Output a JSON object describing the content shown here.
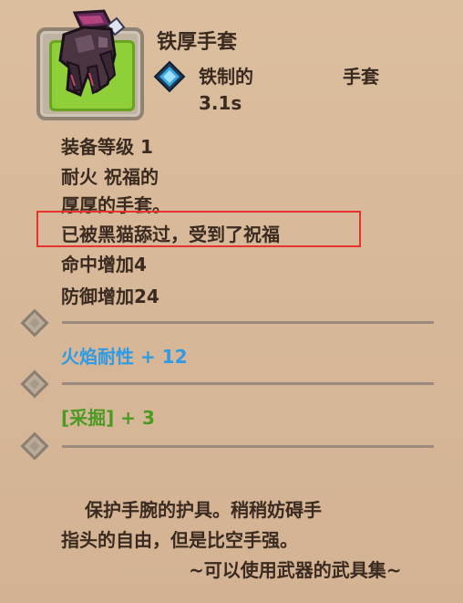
{
  "item": {
    "title": "铁厚手套",
    "material": "铁制的",
    "category": "手套",
    "speed": "3.1s",
    "icon": "glove-icon",
    "rarity_color": "#8ecf3a"
  },
  "description": {
    "lines": [
      "装备等级 1",
      "耐火  祝福的",
      "厚厚的手套。",
      "已被黑猫舔过，受到了祝福",
      "命中增加4",
      "防御增加24"
    ],
    "highlighted_line": "已被黑猫舔过，受到了祝福"
  },
  "enchant_slots": [
    {
      "text": "火焰耐性 + 12",
      "color": "#2f9be4"
    },
    {
      "text": "[采掘] + 3",
      "color": "#4c9a24"
    },
    {
      "text": "",
      "color": ""
    }
  ],
  "flavor": {
    "line1": "保护手腕的护具。稍稍妨碍手",
    "line2": "指头的自由，但是比空手强。",
    "source": "~可以使用武器的武具集~"
  }
}
